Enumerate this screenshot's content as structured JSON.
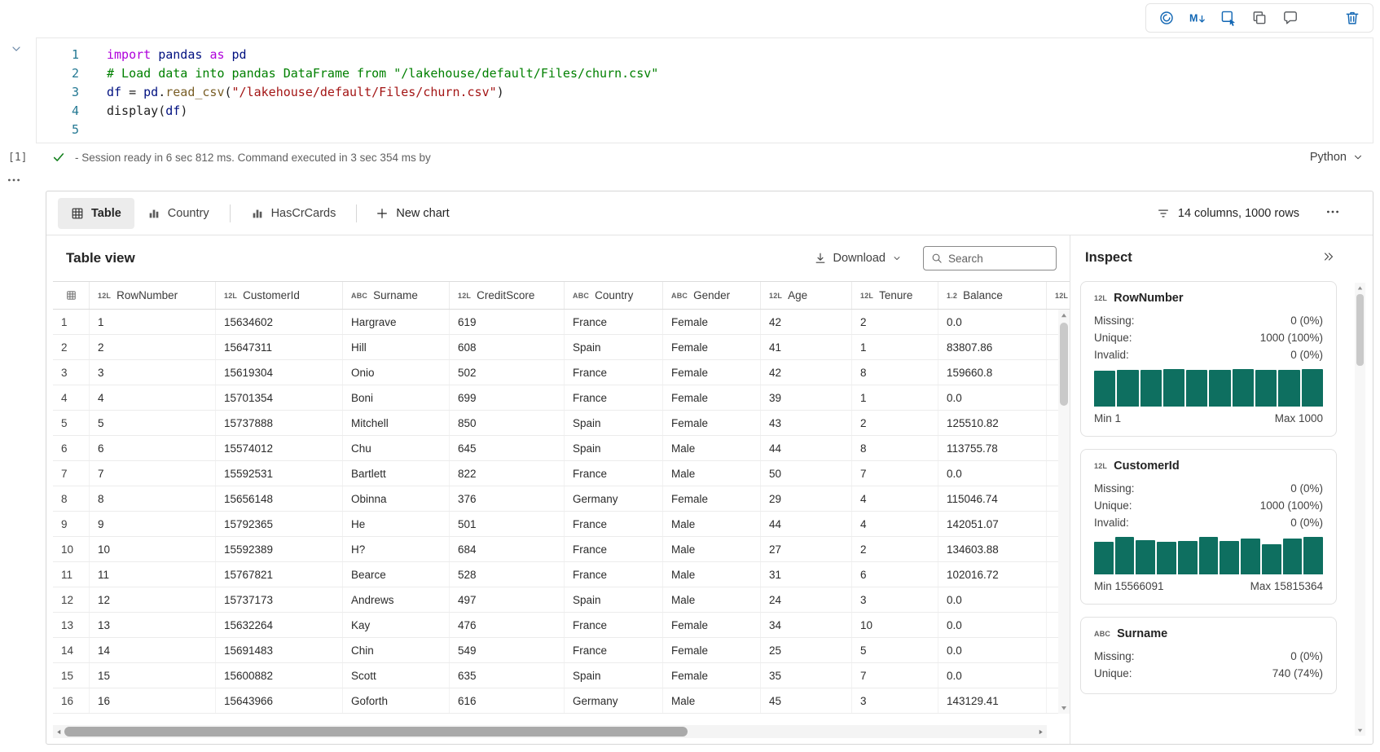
{
  "colors": {
    "histogram_teal": "#0e6f60",
    "accent_blue": "#1267b4",
    "icon_gray": "#5c5f63",
    "success_green": "#12801c",
    "keyword_purple": "#af00db",
    "comment_green": "#008000",
    "string_red": "#a31515",
    "function_brown": "#795e26",
    "variable_blue": "#001080"
  },
  "cell_toolbar": {
    "icons": [
      {
        "name": "copilot",
        "color": "#1267b4"
      },
      {
        "name": "markdown",
        "color": "#1267b4"
      },
      {
        "name": "convert-to-code-cell",
        "color": "#1267b4"
      },
      {
        "name": "copy-cell",
        "color": "#5c5f63"
      },
      {
        "name": "comment",
        "color": "#5c5f63"
      },
      {
        "name": "more-options",
        "color": "#5c5f63"
      },
      {
        "name": "delete-cell",
        "color": "#1267b4"
      }
    ]
  },
  "code_cell": {
    "execution_count": "[1]",
    "status_text": "- Session ready in 6 sec 812 ms. Command executed in 3 sec 354 ms by",
    "language_label": "Python",
    "lines": [
      {
        "num": "1",
        "tokens": [
          {
            "t": "import",
            "c": "kw"
          },
          {
            "t": " ",
            "c": "pl"
          },
          {
            "t": "pandas",
            "c": "var"
          },
          {
            "t": " ",
            "c": "pl"
          },
          {
            "t": "as",
            "c": "kw"
          },
          {
            "t": " ",
            "c": "pl"
          },
          {
            "t": "pd",
            "c": "var"
          }
        ]
      },
      {
        "num": "2",
        "tokens": [
          {
            "t": "# Load data into pandas DataFrame from \"/lakehouse/default/Files/churn.csv\"",
            "c": "cm"
          }
        ]
      },
      {
        "num": "3",
        "tokens": [
          {
            "t": "df",
            "c": "var"
          },
          {
            "t": " = ",
            "c": "pl"
          },
          {
            "t": "pd",
            "c": "var"
          },
          {
            "t": ".",
            "c": "pl"
          },
          {
            "t": "read_csv",
            "c": "fn"
          },
          {
            "t": "(",
            "c": "pl"
          },
          {
            "t": "\"/lakehouse/default/Files/churn.csv\"",
            "c": "str"
          },
          {
            "t": ")",
            "c": "pl"
          }
        ]
      },
      {
        "num": "4",
        "tokens": [
          {
            "t": "display",
            "c": "pl"
          },
          {
            "t": "(",
            "c": "pl"
          },
          {
            "t": "df",
            "c": "var"
          },
          {
            "t": ")",
            "c": "pl"
          }
        ]
      },
      {
        "num": "5",
        "tokens": []
      }
    ]
  },
  "results": {
    "tabs": [
      {
        "label": "Table",
        "icon": "table-grid",
        "selected": true,
        "divider_after": false
      },
      {
        "label": "Country",
        "icon": "bar-chart",
        "selected": false,
        "divider_after": true
      },
      {
        "label": "HasCrCards",
        "icon": "bar-chart",
        "selected": false,
        "divider_after": true
      }
    ],
    "new_chart": {
      "label": "New chart"
    },
    "summary_text": "14 columns, 1000 rows"
  },
  "table_view": {
    "title": "Table view",
    "download_label": "Download",
    "search_placeholder": "Search",
    "columns": [
      {
        "name": "RowNumber",
        "type": "12L"
      },
      {
        "name": "CustomerId",
        "type": "12L"
      },
      {
        "name": "Surname",
        "type": "ABC"
      },
      {
        "name": "CreditScore",
        "type": "12L"
      },
      {
        "name": "Country",
        "type": "ABC"
      },
      {
        "name": "Gender",
        "type": "ABC"
      },
      {
        "name": "Age",
        "type": "12L"
      },
      {
        "name": "Tenure",
        "type": "12L"
      },
      {
        "name": "Balance",
        "type": "1.2"
      },
      {
        "name": "",
        "type": "12L"
      }
    ],
    "rows": [
      [
        "1",
        "1",
        "15634602",
        "Hargrave",
        "619",
        "France",
        "Female",
        "42",
        "2",
        "0.0"
      ],
      [
        "2",
        "2",
        "15647311",
        "Hill",
        "608",
        "Spain",
        "Female",
        "41",
        "1",
        "83807.86"
      ],
      [
        "3",
        "3",
        "15619304",
        "Onio",
        "502",
        "France",
        "Female",
        "42",
        "8",
        "159660.8"
      ],
      [
        "4",
        "4",
        "15701354",
        "Boni",
        "699",
        "France",
        "Female",
        "39",
        "1",
        "0.0"
      ],
      [
        "5",
        "5",
        "15737888",
        "Mitchell",
        "850",
        "Spain",
        "Female",
        "43",
        "2",
        "125510.82"
      ],
      [
        "6",
        "6",
        "15574012",
        "Chu",
        "645",
        "Spain",
        "Male",
        "44",
        "8",
        "113755.78"
      ],
      [
        "7",
        "7",
        "15592531",
        "Bartlett",
        "822",
        "France",
        "Male",
        "50",
        "7",
        "0.0"
      ],
      [
        "8",
        "8",
        "15656148",
        "Obinna",
        "376",
        "Germany",
        "Female",
        "29",
        "4",
        "115046.74"
      ],
      [
        "9",
        "9",
        "15792365",
        "He",
        "501",
        "France",
        "Male",
        "44",
        "4",
        "142051.07"
      ],
      [
        "10",
        "10",
        "15592389",
        "H?",
        "684",
        "France",
        "Male",
        "27",
        "2",
        "134603.88"
      ],
      [
        "11",
        "11",
        "15767821",
        "Bearce",
        "528",
        "France",
        "Male",
        "31",
        "6",
        "102016.72"
      ],
      [
        "12",
        "12",
        "15737173",
        "Andrews",
        "497",
        "Spain",
        "Male",
        "24",
        "3",
        "0.0"
      ],
      [
        "13",
        "13",
        "15632264",
        "Kay",
        "476",
        "France",
        "Female",
        "34",
        "10",
        "0.0"
      ],
      [
        "14",
        "14",
        "15691483",
        "Chin",
        "549",
        "France",
        "Female",
        "25",
        "5",
        "0.0"
      ],
      [
        "15",
        "15",
        "15600882",
        "Scott",
        "635",
        "Spain",
        "Female",
        "35",
        "7",
        "0.0"
      ],
      [
        "16",
        "16",
        "15643966",
        "Goforth",
        "616",
        "Germany",
        "Male",
        "45",
        "3",
        "143129.41"
      ]
    ]
  },
  "inspect": {
    "title": "Inspect",
    "cards": [
      {
        "type": "12L",
        "name": "RowNumber",
        "stats": [
          [
            "Missing:",
            "0 (0%)"
          ],
          [
            "Unique:",
            "1000 (100%)"
          ],
          [
            "Invalid:",
            "0 (0%)"
          ]
        ],
        "histogram": [
          96,
          98,
          97,
          99,
          98,
          97,
          99,
          97,
          98,
          100
        ],
        "min_label": "Min 1",
        "max_label": "Max 1000"
      },
      {
        "type": "12L",
        "name": "CustomerId",
        "stats": [
          [
            "Missing:",
            "0 (0%)"
          ],
          [
            "Unique:",
            "1000 (100%)"
          ],
          [
            "Invalid:",
            "0 (0%)"
          ]
        ],
        "histogram": [
          86,
          100,
          92,
          88,
          90,
          100,
          90,
          95,
          80,
          95,
          100
        ],
        "min_label": "Min 15566091",
        "max_label": "Max 15815364"
      },
      {
        "type": "ABC",
        "name": "Surname",
        "stats": [
          [
            "Missing:",
            "0 (0%)"
          ],
          [
            "Unique:",
            "740 (74%)"
          ]
        ],
        "histogram": null,
        "min_label": null,
        "max_label": null
      }
    ]
  }
}
